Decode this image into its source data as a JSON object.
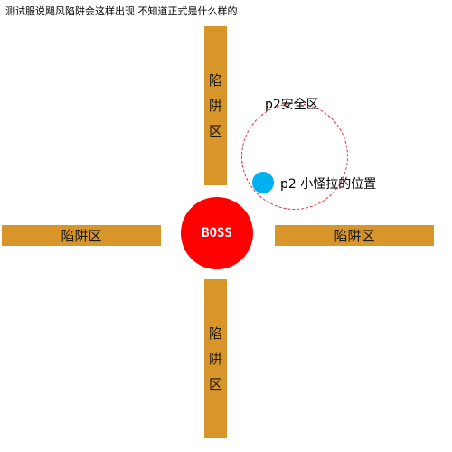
{
  "caption": "测试服说飓风陷阱会这样出现.不知道正式是什么样的",
  "trap_zones": {
    "top": [
      "陷",
      "阱",
      "区"
    ],
    "bottom": [
      "陷",
      "阱",
      "区"
    ],
    "left": "陷阱区",
    "right": "陷阱区"
  },
  "boss": {
    "label": "BOSS",
    "color": "#ff0000"
  },
  "safe_zone": {
    "label": "p2安全区",
    "border_color": "#e8232a"
  },
  "p2": {
    "label": "p2 小怪拉的位置",
    "color": "#00b0ef"
  },
  "colors": {
    "trap_zone": "#d8952a"
  }
}
